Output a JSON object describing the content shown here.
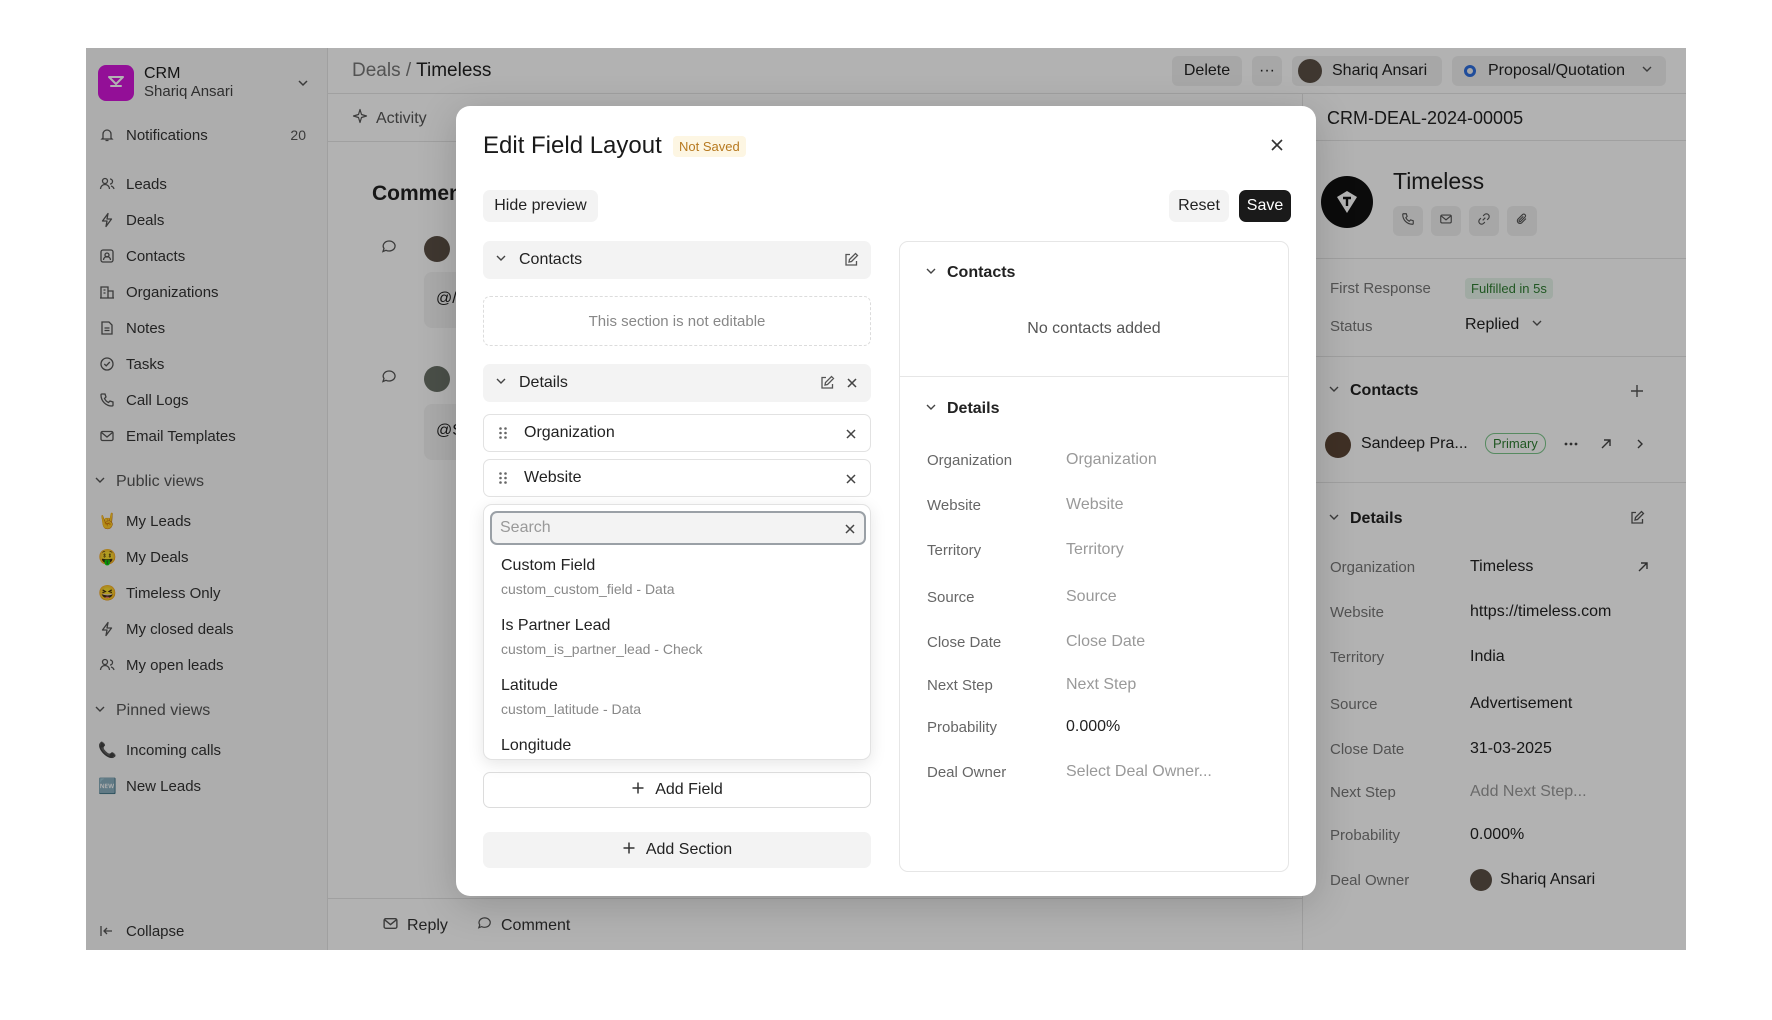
{
  "sidebar": {
    "brand_title": "CRM",
    "brand_user": "Shariq Ansari",
    "notifications_label": "Notifications",
    "notifications_count": "20",
    "nav": [
      "Leads",
      "Deals",
      "Contacts",
      "Organizations",
      "Notes",
      "Tasks",
      "Call Logs",
      "Email Templates"
    ],
    "public_views_label": "Public views",
    "public_views": [
      {
        "emoji": "🤘",
        "label": "My Leads"
      },
      {
        "emoji": "🤑",
        "label": "My Deals"
      },
      {
        "emoji": "😆",
        "label": "Timeless Only"
      },
      {
        "emoji": "",
        "label": "My closed deals"
      },
      {
        "emoji": "",
        "label": "My open leads"
      }
    ],
    "pinned_views_label": "Pinned views",
    "pinned_views": [
      {
        "emoji": "📞",
        "label": "Incoming calls"
      },
      {
        "emoji": "🆕",
        "label": "New Leads"
      }
    ],
    "collapse_label": "Collapse"
  },
  "header": {
    "breadcrumb_parent": "Deals",
    "breadcrumb_sep": " / ",
    "breadcrumb_current": "Timeless",
    "delete_label": "Delete",
    "more_label": "···",
    "user_name": "Shariq Ansari",
    "status_label": "Proposal/Quotation",
    "status_color": "#2f6fde"
  },
  "tabs": {
    "activity": "Activity"
  },
  "main": {
    "comments_heading": "Commen",
    "mention1": "@/",
    "mention2": "@S"
  },
  "bottom": {
    "reply": "Reply",
    "comment": "Comment"
  },
  "right_panel": {
    "deal_id": "CRM-DEAL-2024-00005",
    "org_name": "Timeless",
    "first_response_label": "First Response",
    "first_response_value": "Fulfilled in 5s",
    "status_label": "Status",
    "status_value": "Replied",
    "contacts_heading": "Contacts",
    "contact_name": "Sandeep Pra...",
    "contact_badge": "Primary",
    "details_heading": "Details",
    "details": [
      {
        "label": "Organization",
        "value": "Timeless"
      },
      {
        "label": "Website",
        "value": "https://timeless.com"
      },
      {
        "label": "Territory",
        "value": "India"
      },
      {
        "label": "Source",
        "value": "Advertisement"
      },
      {
        "label": "Close Date",
        "value": "31-03-2025"
      },
      {
        "label": "Next Step",
        "value": "Add Next Step..."
      },
      {
        "label": "Probability",
        "value": "0.000%"
      },
      {
        "label": "Deal Owner",
        "value": "Shariq Ansari"
      }
    ]
  },
  "modal": {
    "title": "Edit Field Layout",
    "not_saved": "Not Saved",
    "hide_preview": "Hide preview",
    "reset": "Reset",
    "save": "Save",
    "contacts_section": "Contacts",
    "not_editable": "This section is not editable",
    "details_section": "Details",
    "fields": [
      "Organization",
      "Website"
    ],
    "search_placeholder": "Search",
    "options": [
      {
        "label": "Custom Field",
        "sub": "custom_custom_field - Data"
      },
      {
        "label": "Is Partner Lead",
        "sub": "custom_is_partner_lead - Check"
      },
      {
        "label": "Latitude",
        "sub": "custom_latitude - Data"
      },
      {
        "label": "Longitude",
        "sub": ""
      }
    ],
    "add_field": "Add Field",
    "add_section": "Add Section",
    "preview": {
      "contacts_heading": "Contacts",
      "no_contacts": "No contacts added",
      "details_heading": "Details",
      "rows": [
        {
          "label": "Organization",
          "value": "Organization"
        },
        {
          "label": "Website",
          "value": "Website"
        },
        {
          "label": "Territory",
          "value": "Territory"
        },
        {
          "label": "Source",
          "value": "Source"
        },
        {
          "label": "Close Date",
          "value": "Close Date"
        },
        {
          "label": "Next Step",
          "value": "Next Step"
        },
        {
          "label": "Probability",
          "value": "0.000%"
        },
        {
          "label": "Deal Owner",
          "value": "Select Deal Owner..."
        }
      ]
    }
  }
}
